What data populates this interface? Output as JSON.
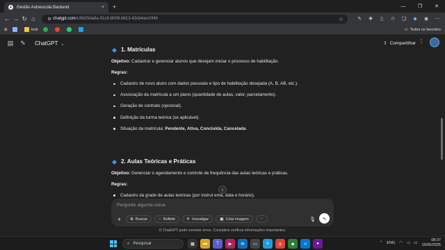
{
  "browser": {
    "tab_title": "Gestão Autoescola Backend",
    "tab_close": "×",
    "new_tab": "+",
    "url_host": "chatgpt.com",
    "url_path": "/c/6825da8a-51c8-8008-b613-43cb4acc0f4b",
    "window_controls": [
      "—",
      "❐",
      "✕"
    ],
    "bookmarks": [
      {
        "label": "",
        "color": "#8ab4f8"
      },
      {
        "label": "look",
        "color": "#f4c542"
      },
      {
        "label": "",
        "color": "#34a853"
      },
      {
        "label": "",
        "color": "#ea4335"
      },
      {
        "label": "",
        "color": "#25d366"
      },
      {
        "label": "",
        "color": "#1da1f2"
      }
    ],
    "all_favorites": "Todos os favoritos"
  },
  "header": {
    "model_label": "ChatGPT",
    "share_label": "Compartilhar",
    "more_label": "⋮"
  },
  "content": {
    "section1": {
      "title": "1. Matrículas",
      "objective_label": "Objetivo:",
      "objective_text": " Cadastrar e gerenciar alunos que desejam iniciar o processo de habilitação.",
      "rules_label": "Regras:",
      "rules": [
        "Cadastro de novo aluno com dados pessoais e tipo de habilitação desejada (A, B, AB, etc.).",
        "Associação da matrícula a um plano (quantidade de aulas, valor, parcelamento).",
        "Geração de contrato (opcional).",
        "Definição da turma teórica (se aplicável)."
      ],
      "status_prefix": "Situação da matrícula: ",
      "status_values": "Pendente, Ativa, Concluída, Cancelada",
      "status_suffix": "."
    },
    "section2": {
      "title": "2. Aulas Teóricas e Práticas",
      "objective_label": "Objetivo:",
      "objective_text": " Gerenciar o agendamento e controle de frequência das aulas teóricas e práticas.",
      "rules_label": "Regras:",
      "rules": [
        "Cadastro da grade de aulas teóricas (por instrut    ema, data e horário)."
      ]
    }
  },
  "composer": {
    "placeholder": "Pergunte alguma coisa",
    "buttons": {
      "search": "Buscar",
      "reason": "Refletir",
      "research": "Investigar",
      "image": "Criar imagem"
    },
    "disclaimer": "O ChatGPT pode cometer erros. Considere verificar informações importantes."
  },
  "taskbar": {
    "search_placeholder": "Pesquisar",
    "language": "ENG",
    "time": "08:37",
    "date": "15/05/2025"
  },
  "colors": {
    "accent": "#4a8bf0",
    "background": "#212121",
    "composer": "#303030"
  }
}
